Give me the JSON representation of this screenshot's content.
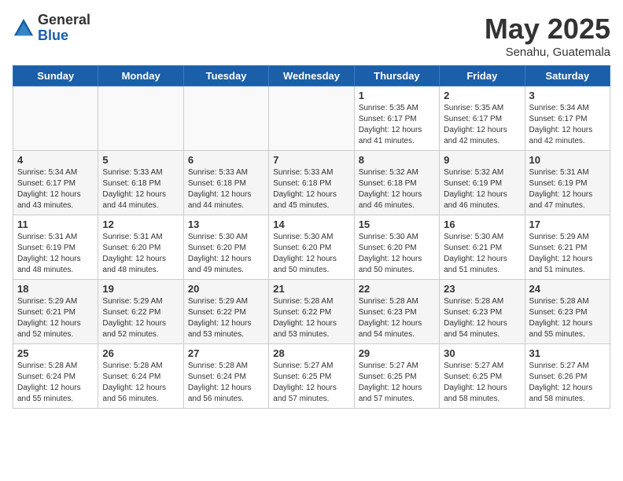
{
  "logo": {
    "general": "General",
    "blue": "Blue"
  },
  "title": "May 2025",
  "location": "Senahu, Guatemala",
  "days_of_week": [
    "Sunday",
    "Monday",
    "Tuesday",
    "Wednesday",
    "Thursday",
    "Friday",
    "Saturday"
  ],
  "weeks": [
    [
      {
        "day": "",
        "info": ""
      },
      {
        "day": "",
        "info": ""
      },
      {
        "day": "",
        "info": ""
      },
      {
        "day": "",
        "info": ""
      },
      {
        "day": "1",
        "info": "Sunrise: 5:35 AM\nSunset: 6:17 PM\nDaylight: 12 hours\nand 41 minutes."
      },
      {
        "day": "2",
        "info": "Sunrise: 5:35 AM\nSunset: 6:17 PM\nDaylight: 12 hours\nand 42 minutes."
      },
      {
        "day": "3",
        "info": "Sunrise: 5:34 AM\nSunset: 6:17 PM\nDaylight: 12 hours\nand 42 minutes."
      }
    ],
    [
      {
        "day": "4",
        "info": "Sunrise: 5:34 AM\nSunset: 6:17 PM\nDaylight: 12 hours\nand 43 minutes."
      },
      {
        "day": "5",
        "info": "Sunrise: 5:33 AM\nSunset: 6:18 PM\nDaylight: 12 hours\nand 44 minutes."
      },
      {
        "day": "6",
        "info": "Sunrise: 5:33 AM\nSunset: 6:18 PM\nDaylight: 12 hours\nand 44 minutes."
      },
      {
        "day": "7",
        "info": "Sunrise: 5:33 AM\nSunset: 6:18 PM\nDaylight: 12 hours\nand 45 minutes."
      },
      {
        "day": "8",
        "info": "Sunrise: 5:32 AM\nSunset: 6:18 PM\nDaylight: 12 hours\nand 46 minutes."
      },
      {
        "day": "9",
        "info": "Sunrise: 5:32 AM\nSunset: 6:19 PM\nDaylight: 12 hours\nand 46 minutes."
      },
      {
        "day": "10",
        "info": "Sunrise: 5:31 AM\nSunset: 6:19 PM\nDaylight: 12 hours\nand 47 minutes."
      }
    ],
    [
      {
        "day": "11",
        "info": "Sunrise: 5:31 AM\nSunset: 6:19 PM\nDaylight: 12 hours\nand 48 minutes."
      },
      {
        "day": "12",
        "info": "Sunrise: 5:31 AM\nSunset: 6:20 PM\nDaylight: 12 hours\nand 48 minutes."
      },
      {
        "day": "13",
        "info": "Sunrise: 5:30 AM\nSunset: 6:20 PM\nDaylight: 12 hours\nand 49 minutes."
      },
      {
        "day": "14",
        "info": "Sunrise: 5:30 AM\nSunset: 6:20 PM\nDaylight: 12 hours\nand 50 minutes."
      },
      {
        "day": "15",
        "info": "Sunrise: 5:30 AM\nSunset: 6:20 PM\nDaylight: 12 hours\nand 50 minutes."
      },
      {
        "day": "16",
        "info": "Sunrise: 5:30 AM\nSunset: 6:21 PM\nDaylight: 12 hours\nand 51 minutes."
      },
      {
        "day": "17",
        "info": "Sunrise: 5:29 AM\nSunset: 6:21 PM\nDaylight: 12 hours\nand 51 minutes."
      }
    ],
    [
      {
        "day": "18",
        "info": "Sunrise: 5:29 AM\nSunset: 6:21 PM\nDaylight: 12 hours\nand 52 minutes."
      },
      {
        "day": "19",
        "info": "Sunrise: 5:29 AM\nSunset: 6:22 PM\nDaylight: 12 hours\nand 52 minutes."
      },
      {
        "day": "20",
        "info": "Sunrise: 5:29 AM\nSunset: 6:22 PM\nDaylight: 12 hours\nand 53 minutes."
      },
      {
        "day": "21",
        "info": "Sunrise: 5:28 AM\nSunset: 6:22 PM\nDaylight: 12 hours\nand 53 minutes."
      },
      {
        "day": "22",
        "info": "Sunrise: 5:28 AM\nSunset: 6:23 PM\nDaylight: 12 hours\nand 54 minutes."
      },
      {
        "day": "23",
        "info": "Sunrise: 5:28 AM\nSunset: 6:23 PM\nDaylight: 12 hours\nand 54 minutes."
      },
      {
        "day": "24",
        "info": "Sunrise: 5:28 AM\nSunset: 6:23 PM\nDaylight: 12 hours\nand 55 minutes."
      }
    ],
    [
      {
        "day": "25",
        "info": "Sunrise: 5:28 AM\nSunset: 6:24 PM\nDaylight: 12 hours\nand 55 minutes."
      },
      {
        "day": "26",
        "info": "Sunrise: 5:28 AM\nSunset: 6:24 PM\nDaylight: 12 hours\nand 56 minutes."
      },
      {
        "day": "27",
        "info": "Sunrise: 5:28 AM\nSunset: 6:24 PM\nDaylight: 12 hours\nand 56 minutes."
      },
      {
        "day": "28",
        "info": "Sunrise: 5:27 AM\nSunset: 6:25 PM\nDaylight: 12 hours\nand 57 minutes."
      },
      {
        "day": "29",
        "info": "Sunrise: 5:27 AM\nSunset: 6:25 PM\nDaylight: 12 hours\nand 57 minutes."
      },
      {
        "day": "30",
        "info": "Sunrise: 5:27 AM\nSunset: 6:25 PM\nDaylight: 12 hours\nand 58 minutes."
      },
      {
        "day": "31",
        "info": "Sunrise: 5:27 AM\nSunset: 6:26 PM\nDaylight: 12 hours\nand 58 minutes."
      }
    ]
  ]
}
